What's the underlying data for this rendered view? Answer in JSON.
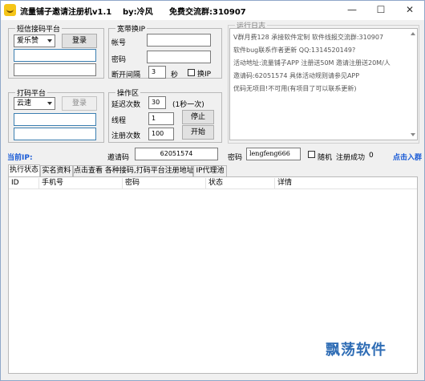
{
  "titlebar": {
    "app_title": "流量铺子邀请注册机v1.1",
    "author": "by:冷风",
    "group": "免费交流群:310907",
    "minimize_glyph": "—",
    "maximize_glyph": "☐",
    "close_glyph": "✕"
  },
  "sms_platform": {
    "legend": "短信接码平台",
    "platform_selected": "爱乐赞",
    "login_label": "登录",
    "field1_value": "",
    "field2_value": ""
  },
  "proxy": {
    "legend": "宽带换IP",
    "account_label": "帐号",
    "account_value": "",
    "password_label": "密码",
    "password_value": "",
    "interval_label": "断开间隔",
    "interval_value": "3",
    "seconds_label": "秒",
    "switch_ip_label": "换IP"
  },
  "runlog": {
    "legend": "运行日志",
    "lines": [
      "V群月费128  承接软件定制  软件线报交流群:310907",
      "软件bug联系作者更新 QQ:1314520149?",
      "活动地址:流量铺子APP 注册送50M 邀请注册送20M/人",
      "邀请码:62051574    具体活动规则请参见APP",
      "优码无项目!不可用(有项目了可以联系更新)"
    ]
  },
  "captcha_platform": {
    "legend": "打码平台",
    "platform_selected": "云速",
    "login_label": "登录",
    "field1_value": "",
    "field2_value": ""
  },
  "operation": {
    "legend": "操作区",
    "delay_label": "延迟次数",
    "delay_value": "30",
    "delay_hint": "(1秒一次)",
    "threads_label": "线程",
    "threads_value": "1",
    "stop_label": "停止",
    "register_count_label": "注册次数",
    "register_count_value": "100",
    "start_label": "开始"
  },
  "statusbar": {
    "current_ip_label": "当前IP:",
    "invite_label": "邀请码",
    "invite_value": "62051574",
    "password_label": "密码",
    "password_value": "lengfeng666",
    "random_label": "随机",
    "success_label": "注册成功",
    "success_value": "0",
    "join_group_label": "点击入群"
  },
  "tabs": [
    {
      "label": "执行状态"
    },
    {
      "label": "实名资料"
    },
    {
      "label": "点击查看 各种接码,打码平台注册地址"
    },
    {
      "label": "IP代理池"
    }
  ],
  "table": {
    "columns": [
      "ID",
      "手机号",
      "密码",
      "状态",
      "详情"
    ],
    "rows": []
  },
  "watermark": "飘荡软件",
  "colors": {
    "link_blue": "#1a5bd6",
    "watermark_blue": "#2f6db5",
    "field_border_blue": "#3c7fb1"
  }
}
